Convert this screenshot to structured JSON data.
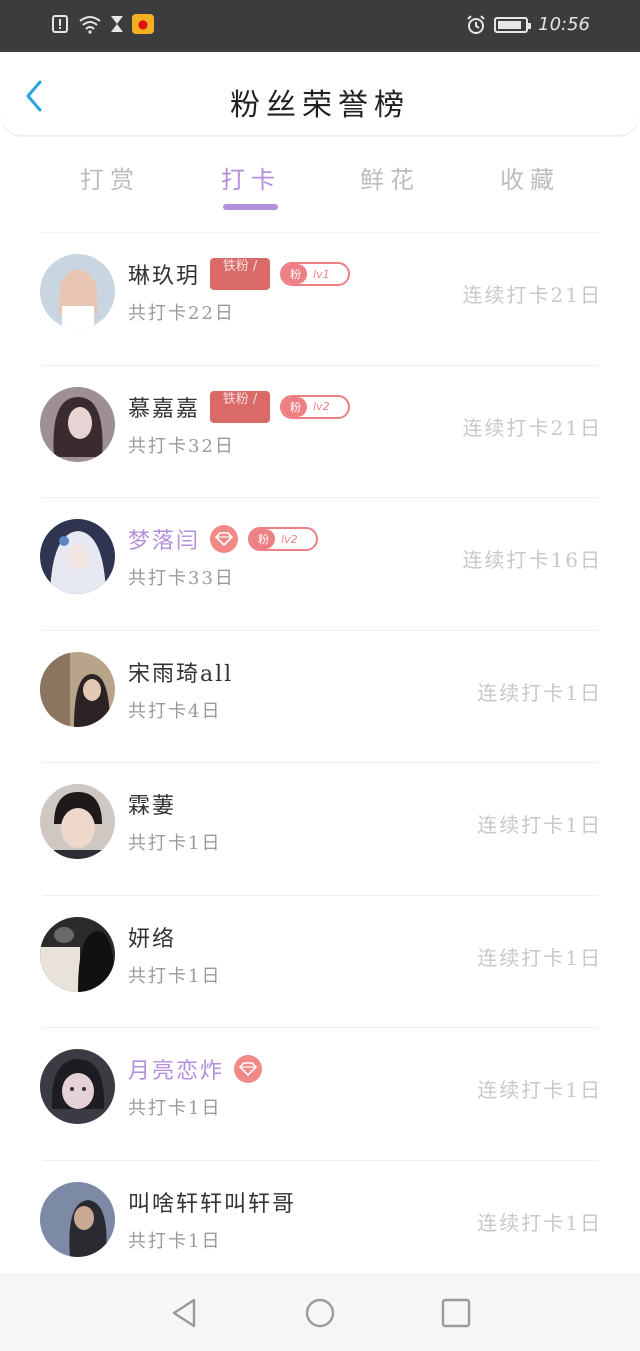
{
  "status_bar": {
    "time": "10:56",
    "icons": [
      "alert-icon",
      "wifi-icon",
      "hourglass-icon",
      "weibo-icon",
      "alarm-icon",
      "battery-icon"
    ],
    "battery_level": 0.9
  },
  "header": {
    "title": "粉丝荣誉榜",
    "back_icon": "chevron-left-icon"
  },
  "tabs": {
    "items": [
      "打赏",
      "打卡",
      "鲜花",
      "收藏"
    ],
    "active_index": 1
  },
  "list": {
    "rows": [
      {
        "name": "琳玖玥",
        "vip": false,
        "gift_badge": "铁粉 /",
        "level_pill": {
          "fan": "粉",
          "lv": "lv1"
        },
        "total": "共打卡22日",
        "streak": "连续打卡21日"
      },
      {
        "name": "慕嘉嘉",
        "vip": false,
        "gift_badge": "铁粉 /",
        "level_pill": {
          "fan": "粉",
          "lv": "lv2"
        },
        "total": "共打卡32日",
        "streak": "连续打卡21日"
      },
      {
        "name": "梦落闫",
        "vip": true,
        "diamond": true,
        "level_pill": {
          "fan": "粉",
          "lv": "lv2"
        },
        "total": "共打卡33日",
        "streak": "连续打卡16日"
      },
      {
        "name": "宋雨琦all",
        "vip": false,
        "total": "共打卡4日",
        "streak": "连续打卡1日"
      },
      {
        "name": "霖萋",
        "vip": false,
        "total": "共打卡1日",
        "streak": "连续打卡1日"
      },
      {
        "name": "妍络",
        "vip": false,
        "total": "共打卡1日",
        "streak": "连续打卡1日"
      },
      {
        "name": "月亮恋炸",
        "vip": true,
        "diamond": true,
        "total": "共打卡1日",
        "streak": "连续打卡1日"
      },
      {
        "name": "叫啥轩轩叫轩哥",
        "vip": false,
        "total": "共打卡1日",
        "streak": "连续打卡1日"
      }
    ]
  },
  "colors": {
    "accent": "#b48fdb",
    "badge_red": "#d96a68",
    "pill_pink": "#ee7f84",
    "muted": "#c8c8c8"
  },
  "nav_bar": {
    "icons": [
      "back-triangle-icon",
      "home-circle-icon",
      "recents-square-icon"
    ]
  }
}
